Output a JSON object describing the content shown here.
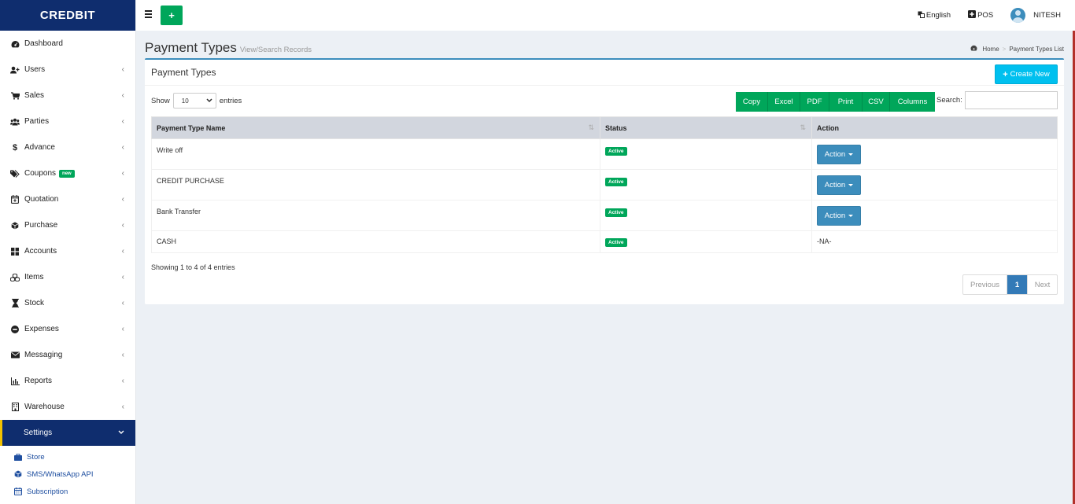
{
  "brand": "CREDBIT",
  "header": {
    "language": "English",
    "pos": "POS",
    "user": "NITESH"
  },
  "sidebar": {
    "items": [
      {
        "label": "Dashboard",
        "icon": "dashboard-icon"
      },
      {
        "label": "Users",
        "icon": "user-plus-icon"
      },
      {
        "label": "Sales",
        "icon": "cart-icon"
      },
      {
        "label": "Parties",
        "icon": "users-icon"
      },
      {
        "label": "Advance",
        "icon": "dollar-icon"
      },
      {
        "label": "Coupons",
        "icon": "tags-icon",
        "badge": "new"
      },
      {
        "label": "Quotation",
        "icon": "calendar-plus-icon"
      },
      {
        "label": "Purchase",
        "icon": "cube-icon"
      },
      {
        "label": "Accounts",
        "icon": "th-large-icon"
      },
      {
        "label": "Items",
        "icon": "cubes-icon"
      },
      {
        "label": "Stock",
        "icon": "hourglass-icon"
      },
      {
        "label": "Expenses",
        "icon": "minus-circle-icon"
      },
      {
        "label": "Messaging",
        "icon": "envelope-icon"
      },
      {
        "label": "Reports",
        "icon": "bar-chart-icon"
      },
      {
        "label": "Warehouse",
        "icon": "building-icon"
      },
      {
        "label": "Settings",
        "icon": "settings-icon"
      }
    ],
    "sub_items": [
      {
        "label": "Store",
        "icon": "suitcase-icon"
      },
      {
        "label": "SMS/WhatsApp API",
        "icon": "cube-icon"
      },
      {
        "label": "Subscription",
        "icon": "calendar-icon"
      }
    ]
  },
  "page": {
    "title": "Payment Types",
    "subtitle": "View/Search Records",
    "breadcrumb_home": "Home",
    "breadcrumb_current": "Payment Types List"
  },
  "box": {
    "title": "Payment Types",
    "create_label": "Create New",
    "show_label": "Show",
    "entries_label": "entries",
    "page_size": "10",
    "search_label": "Search:",
    "export_buttons": [
      "Copy",
      "Excel",
      "PDF",
      "Print",
      "CSV",
      "Columns"
    ]
  },
  "table": {
    "columns": [
      "Payment Type Name",
      "Status",
      "Action"
    ],
    "rows": [
      {
        "name": "Write off",
        "status": "Active",
        "action": "Action"
      },
      {
        "name": "CREDIT PURCHASE",
        "status": "Active",
        "action": "Action"
      },
      {
        "name": "Bank Transfer",
        "status": "Active",
        "action": "Action"
      },
      {
        "name": "CASH",
        "status": "Active",
        "action": "-NA-"
      }
    ],
    "info": "Showing 1 to 4 of 4 entries"
  },
  "pagination": {
    "previous": "Previous",
    "current": "1",
    "next": "Next"
  },
  "colors": {
    "brand_navy": "#0f2d6e",
    "success_green": "#00a65a",
    "info_cyan": "#00c0ef",
    "primary_blue": "#3c8dbc",
    "accent_yellow": "#f2c200"
  }
}
